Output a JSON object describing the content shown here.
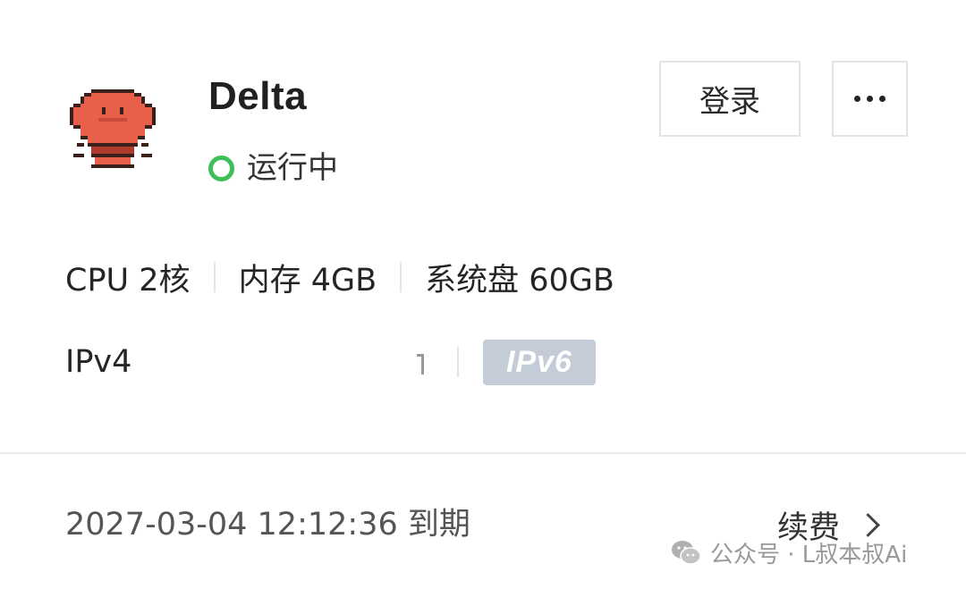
{
  "server": {
    "name": "Delta",
    "status": "运行中",
    "status_color": "#3fbf5a"
  },
  "actions": {
    "login_label": "登录",
    "more_label": "···"
  },
  "specs": {
    "cpu": "CPU 2核",
    "memory": "内存 4GB",
    "disk": "系统盘 60GB"
  },
  "network": {
    "ipv4_label": "IPv4",
    "ipv6_badge": "IPv6",
    "ipv6_badge_color": "#c4ccd8"
  },
  "billing": {
    "expiry": "2027-03-04 12:12:36 到期",
    "renew_label": "续费"
  },
  "watermark": {
    "text": "公众号 · L叔本叔Ai"
  },
  "icons": {
    "avatar": "pixel-avatar-icon",
    "status": "status-ring-icon",
    "more": "more-dots-icon",
    "renew": "chevron-right-icon",
    "watermark": "wechat-icon"
  }
}
